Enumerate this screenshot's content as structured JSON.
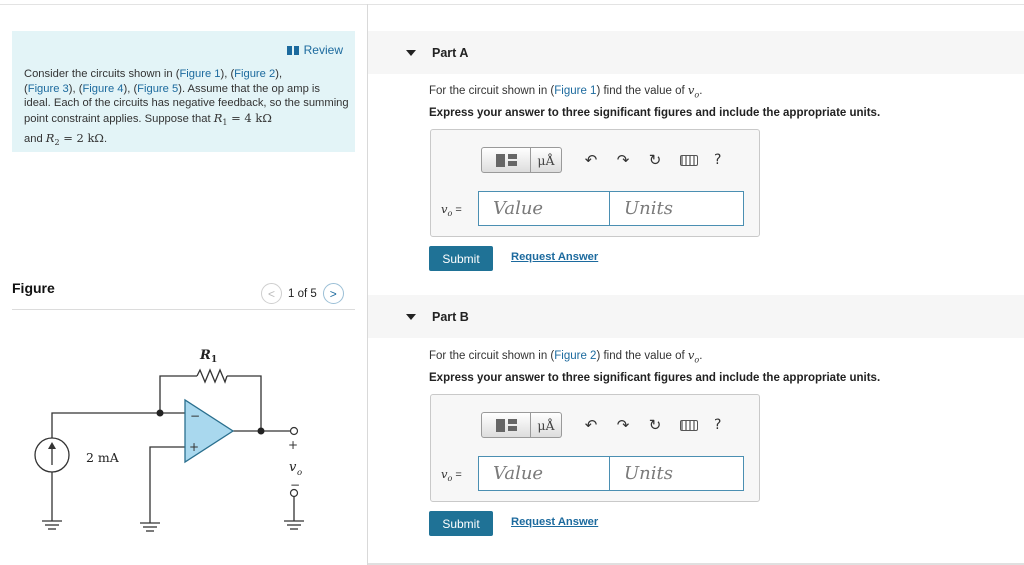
{
  "review": {
    "label": "Review"
  },
  "intro": {
    "p1": "Consider the circuits shown in (",
    "fig1": "Figure 1",
    "sep1": "), (",
    "fig2": "Figure 2",
    "sep2": "),",
    "sep3": "(",
    "fig3": "Figure 3",
    "sep4": "), (",
    "fig4": "Figure 4",
    "sep5": "), (",
    "fig5": "Figure 5",
    "p2": "). Assume that the op amp is ideal. Each of the circuits has negative feedback, so the summing point constraint applies. Suppose that ",
    "r1": "R",
    "r1sub": "1",
    "r1val": " = 4 kΩ",
    "p3": "and ",
    "r2": "R",
    "r2sub": "2",
    "r2val": " = 2 kΩ",
    "p4": "."
  },
  "figure": {
    "title": "Figure",
    "pager": "1 of 5",
    "prev": "<",
    "next": ">",
    "circuit": {
      "r1_label": "R",
      "r1_sub": "1",
      "source_label": "2 mA",
      "minus": "−",
      "plus": "+",
      "out_plus": "+",
      "out_label": "v",
      "out_sub": "o",
      "out_minus": "−"
    }
  },
  "parts": [
    {
      "title": "Part A",
      "q_prefix": "For the circuit shown in (",
      "q_link": "Figure 1",
      "q_suffix": ") find the value of ",
      "var": "v",
      "var_sub": "o",
      "q_end": ".",
      "instruction": "Express your answer to three significant figures and include the appropriate units.",
      "label_var": "v",
      "label_sub": "o",
      "label_eq": " =",
      "value_placeholder": "Value",
      "units_placeholder": "Units",
      "submit": "Submit",
      "request": "Request Answer"
    },
    {
      "title": "Part B",
      "q_prefix": "For the circuit shown in (",
      "q_link": "Figure 2",
      "q_suffix": ") find the value of ",
      "var": "v",
      "var_sub": "o",
      "q_end": ".",
      "instruction": "Express your answer to three significant figures and include the appropriate units.",
      "label_var": "v",
      "label_sub": "o",
      "label_eq": " =",
      "value_placeholder": "Value",
      "units_placeholder": "Units",
      "submit": "Submit",
      "request": "Request Answer"
    }
  ],
  "toolbar": {
    "units_btn": "μÅ",
    "undo_icon": "undo-icon",
    "redo_icon": "redo-icon",
    "reset_icon": "reset-icon",
    "keyboard_icon": "keyboard-icon",
    "help": "?"
  },
  "colors": {
    "link": "#1c6a9e",
    "submit": "#1f7296",
    "intro_bg": "#e3f4f7",
    "opamp_fill": "#a9d8ee"
  }
}
